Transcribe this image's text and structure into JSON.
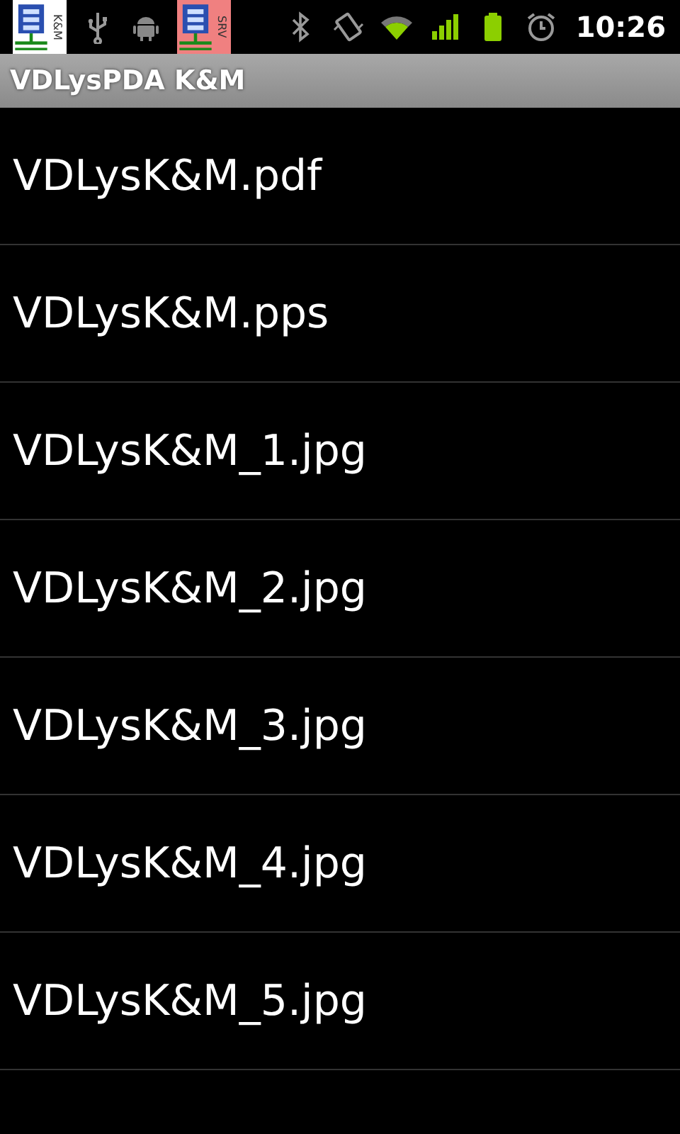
{
  "status_bar": {
    "notifications": [
      {
        "label": "K&M",
        "color": "#ffffff"
      },
      {
        "label": "SRV",
        "color": "#f08080"
      }
    ],
    "time": "10:26"
  },
  "window": {
    "title": "VDLysPDA K&M"
  },
  "files": [
    {
      "name": "VDLysK&M.pdf"
    },
    {
      "name": "VDLysK&M.pps"
    },
    {
      "name": "VDLysK&M_1.jpg"
    },
    {
      "name": "VDLysK&M_2.jpg"
    },
    {
      "name": "VDLysK&M_3.jpg"
    },
    {
      "name": "VDLysK&M_4.jpg"
    },
    {
      "name": "VDLysK&M_5.jpg"
    }
  ]
}
